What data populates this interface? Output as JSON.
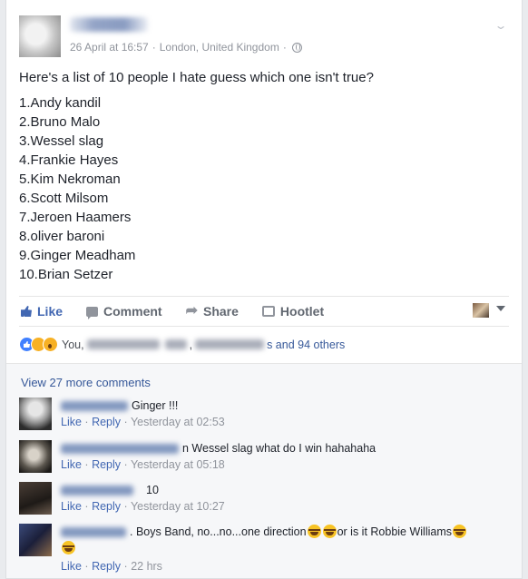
{
  "post": {
    "timestamp": "26 April at 16:57",
    "separator": "·",
    "location": "London, United Kingdom",
    "separator2": "·",
    "text": "Here's a list of 10 people I hate guess which one isn't true?",
    "people": [
      "1.Andy kandil",
      "2.Bruno Malo",
      "3.Wessel slag",
      "4.Frankie Hayes",
      "5.Kim Nekroman",
      "6.Scott Milsom",
      "7.Jeroen Haamers",
      "8.oliver baroni",
      "9.Ginger Meadham",
      "10.Brian Setzer"
    ]
  },
  "actions": {
    "like": "Like",
    "comment": "Comment",
    "share": "Share",
    "hootlet": "Hootlet"
  },
  "reactions": {
    "you": "You,",
    "comma": ",",
    "and_others": "s and 94 others"
  },
  "view_more": "View 27 more comments",
  "comments": [
    {
      "text": "Ginger !!!",
      "like": "Like",
      "dot1": "·",
      "reply": "Reply",
      "dot2": "·",
      "time": "Yesterday at 02:53"
    },
    {
      "text": "n Wessel slag what do I win hahahaha",
      "like": "Like",
      "dot1": "·",
      "reply": "Reply",
      "dot2": "·",
      "time": "Yesterday at 05:18"
    },
    {
      "text": "10",
      "like": "Like",
      "dot1": "·",
      "reply": "Reply",
      "dot2": "·",
      "time": "Yesterday at 10:27"
    },
    {
      "text_a": ". Boys Band, no...no...one direction",
      "text_b": "or is it Robbie Williams",
      "like": "Like",
      "dot1": "·",
      "reply": "Reply",
      "dot2": "·",
      "time": "22 hrs"
    }
  ],
  "colors": {
    "link_blue": "#365899",
    "like_blue": "#4267b2",
    "meta_gray": "#90949c",
    "comments_bg": "#f6f7f9"
  }
}
